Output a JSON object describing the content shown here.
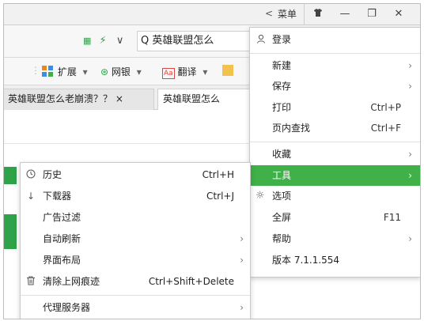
{
  "titlebar": {
    "menu_label": "菜单",
    "back_glyph": "<",
    "buttons": [
      "👕",
      "—",
      "❐",
      "✕"
    ]
  },
  "address": {
    "url_text": "Q 英雄联盟怎么"
  },
  "extensions": [
    {
      "label": "扩展"
    },
    {
      "label": "网银"
    },
    {
      "label": "翻译"
    }
  ],
  "tabs": [
    {
      "label": "英雄联盟怎么老崩溃？？ ×"
    },
    {
      "label": "英雄联盟怎么"
    }
  ],
  "main_menu": {
    "items": [
      {
        "label": "登录"
      },
      {
        "label": "新建"
      },
      {
        "label": "保存"
      },
      {
        "label": "打印",
        "shortcut": "Ctrl+P"
      },
      {
        "label": "页内查找",
        "shortcut": "Ctrl+F"
      },
      {
        "label": "收藏"
      },
      {
        "label": "工具"
      },
      {
        "label": "选项"
      },
      {
        "label": "全屏",
        "shortcut": "F11"
      },
      {
        "label": "帮助"
      },
      {
        "label": "版本 7.1.1.554"
      }
    ]
  },
  "tools_menu": {
    "items": [
      {
        "label": "历史",
        "shortcut": "Ctrl+H"
      },
      {
        "label": "下载器",
        "shortcut": "Ctrl+J"
      },
      {
        "label": "广告过滤"
      },
      {
        "label": "自动刷新"
      },
      {
        "label": "界面布局"
      },
      {
        "label": "清除上网痕迹",
        "shortcut": "Ctrl+Shift+Delete"
      },
      {
        "label": "代理服务器"
      }
    ]
  },
  "colors": {
    "highlight": "#3fb148",
    "accent_green": "#2fa34a"
  }
}
